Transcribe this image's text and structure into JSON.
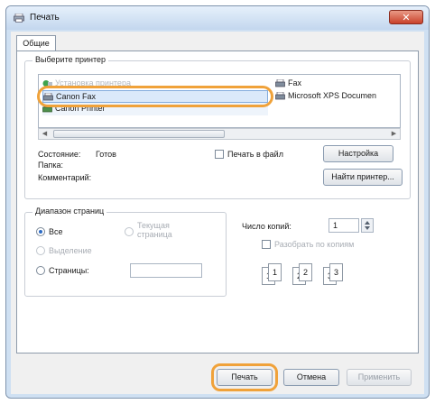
{
  "window": {
    "title": "Печать",
    "close_glyph": "✕"
  },
  "tab": {
    "label": "Общие"
  },
  "select_printer": {
    "group_label": "Выберите принтер",
    "printers_left": [
      {
        "name": "Установка принтера",
        "state": "faded",
        "icon": "add-printer-icon"
      },
      {
        "name": "Canon Fax",
        "state": "selected",
        "icon": "fax-icon"
      },
      {
        "name": "Canon Printer",
        "state": "normal",
        "icon": "printer-icon"
      }
    ],
    "printers_right": [
      {
        "name": "Fax",
        "icon": "fax-icon"
      },
      {
        "name": "Microsoft XPS Documen",
        "icon": "printer-icon"
      }
    ],
    "scroll_left": "◀",
    "scroll_right": "▶",
    "status_label": "Состояние:",
    "status_value": "Готов",
    "location_label": "Папка:",
    "comment_label": "Комментарий:",
    "print_to_file_label": "Печать в файл",
    "preferences_button": "Настройка",
    "find_printer_button": "Найти принтер..."
  },
  "page_range": {
    "group_label": "Диапазон страниц",
    "all_label": "Все",
    "selection_label": "Выделение",
    "current_page_label": "Текущая страница",
    "pages_label": "Страницы:",
    "pages_value": ""
  },
  "copies": {
    "number_label": "Число копий:",
    "number_value": "1",
    "collate_label": "Разобрать по копиям",
    "collate_pages": [
      "1",
      "1",
      "2",
      "2",
      "3",
      "3"
    ]
  },
  "footer": {
    "print_button": "Печать",
    "cancel_button": "Отмена",
    "apply_button": "Применить"
  },
  "colors": {
    "highlight": "#f0a23a",
    "selection_bg": "#dbe9fa",
    "close_red": "#c9412a"
  }
}
